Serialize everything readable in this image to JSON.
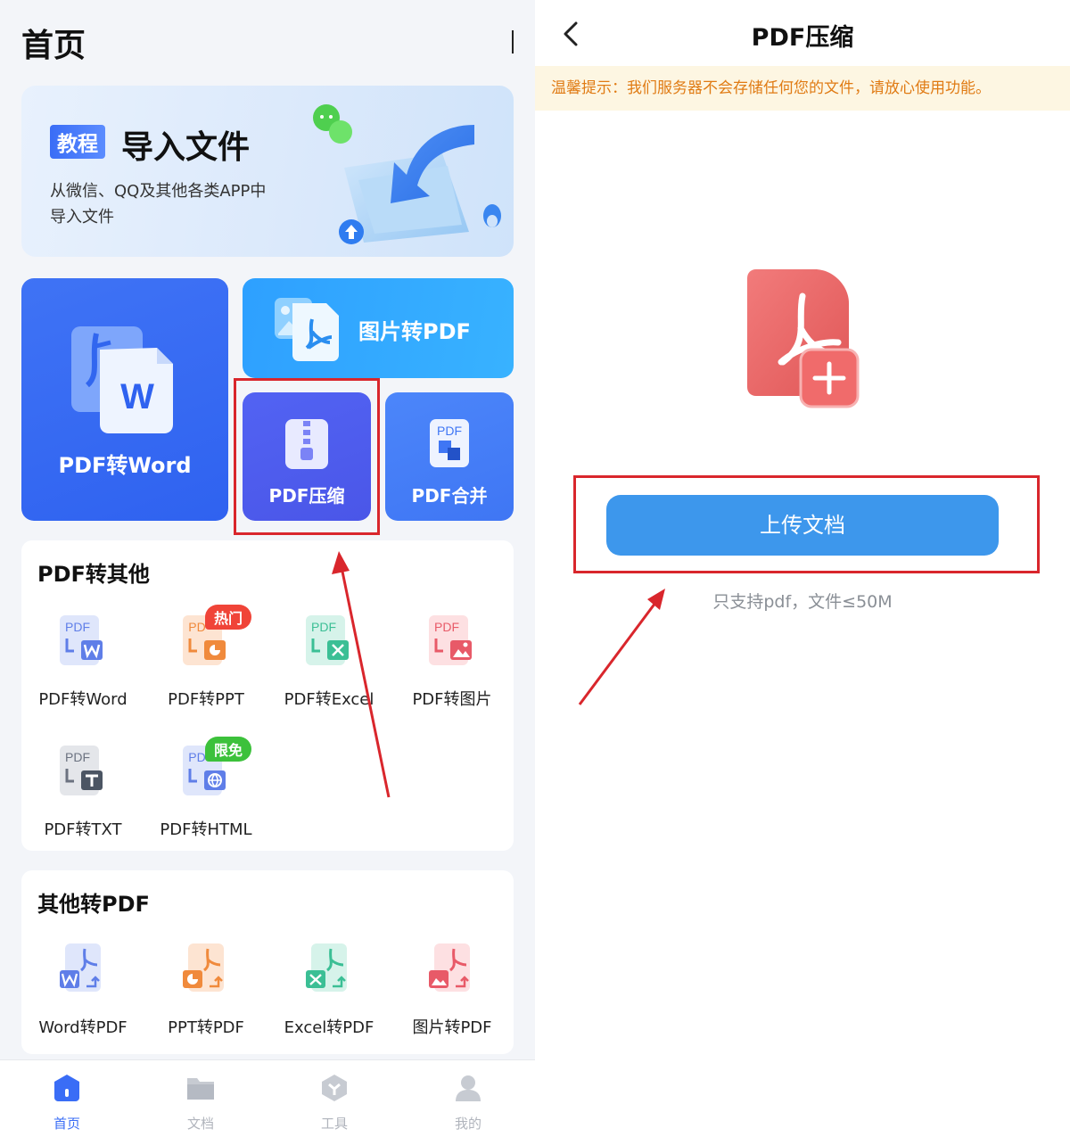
{
  "home": {
    "title": "首页",
    "banner": {
      "tag": "教程",
      "title": "导入文件",
      "desc": "从微信、QQ及其他各类APP中导入文件"
    },
    "cards": {
      "pdf_to_word": "PDF转Word",
      "image_to_pdf": "图片转PDF",
      "pdf_compress": "PDF压缩",
      "pdf_merge": "PDF合并",
      "word_letter": "W",
      "merge_icon_text": "PDF"
    },
    "section_pdf_to_other": {
      "title": "PDF转其他",
      "items": [
        {
          "label": "PDF转Word",
          "icon_text": "PDF"
        },
        {
          "label": "PDF转PPT",
          "icon_text": "PD",
          "badge": "热门"
        },
        {
          "label": "PDF转Excel",
          "icon_text": "PDF"
        },
        {
          "label": "PDF转图片",
          "icon_text": "PDF"
        },
        {
          "label": "PDF转TXT",
          "icon_text": "PDF"
        },
        {
          "label": "PDF转HTML",
          "icon_text": "PD",
          "badge": "限免"
        }
      ]
    },
    "section_other_to_pdf": {
      "title": "其他转PDF",
      "items": [
        {
          "label": "Word转PDF"
        },
        {
          "label": "PPT转PDF"
        },
        {
          "label": "Excel转PDF"
        },
        {
          "label": "图片转PDF"
        }
      ]
    },
    "tabbar": [
      {
        "label": "首页",
        "icon": "home-icon",
        "active": true
      },
      {
        "label": "文档",
        "icon": "folder-icon"
      },
      {
        "label": "工具",
        "icon": "tools-icon"
      },
      {
        "label": "我的",
        "icon": "user-icon"
      }
    ]
  },
  "compress": {
    "title": "PDF压缩",
    "notice": "温馨提示：我们服务器不会存储任何您的文件，请放心使用功能。",
    "upload_label": "上传文档",
    "hint": "只支持pdf，文件≤50M"
  },
  "colors": {
    "accent_blue": "#3a6df6",
    "upload_blue": "#3d97ec",
    "highlight_red": "#d9262c",
    "notice_text": "#e07b14",
    "hot_badge": "#f04438",
    "free_badge": "#3cc13b"
  }
}
